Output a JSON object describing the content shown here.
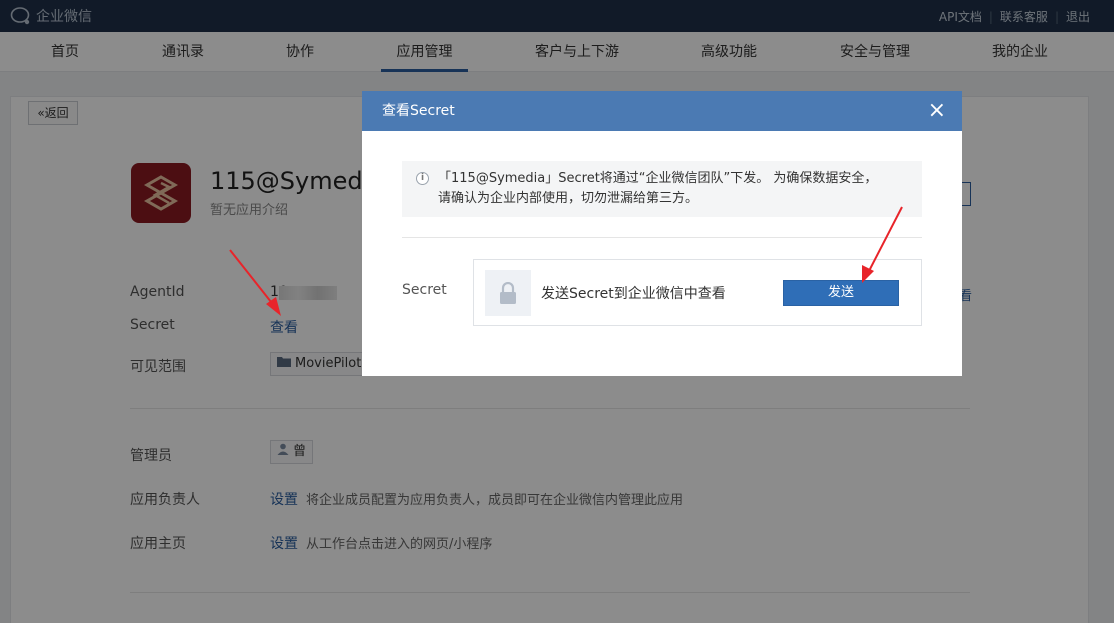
{
  "topbar": {
    "logo_text": "企业微信",
    "links": [
      "API文档",
      "联系客服",
      "退出"
    ]
  },
  "nav": {
    "items": [
      "首页",
      "通讯录",
      "协作",
      "应用管理",
      "客户与上下游",
      "高级功能",
      "安全与管理",
      "我的企业"
    ],
    "active": "应用管理"
  },
  "page": {
    "back_label": "返回",
    "app_name": "115@Symedia",
    "app_desc": "暂无应用介绍",
    "agentid_label": "AgentId",
    "agentid_value": "10",
    "secret_label": "Secret",
    "secret_view_link": "查看",
    "visible_label": "可见范围",
    "visible_value": "MoviePilot",
    "admin_label": "管理员",
    "admin_value": "曾",
    "owner_label": "应用负责人",
    "owner_link": "设置",
    "owner_hint": "将企业成员配置为应用负责人，成员即可在企业微信内管理此应用",
    "homepage_label": "应用主页",
    "homepage_link": "设置",
    "homepage_hint": "从工作台点击进入的网页/小程序",
    "right_link": "看"
  },
  "modal": {
    "title": "查看Secret",
    "close": "×",
    "notice_line1": "「115@Symedia」Secret将通过“企业微信团队”下发。 为确保数据安全，",
    "notice_line2": "请确认为企业内部使用，切勿泄漏给第三方。",
    "secret_label": "Secret",
    "send_text": "发送Secret到企业微信中查看",
    "send_button": "发送"
  }
}
